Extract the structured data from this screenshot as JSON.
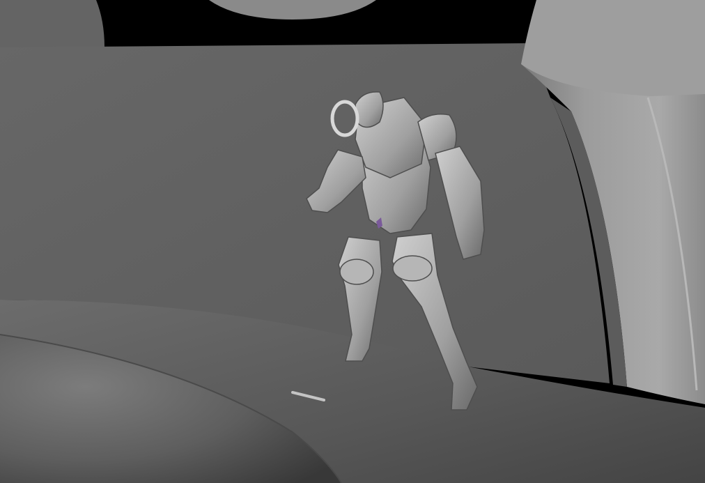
{
  "viewport": {
    "name": "3D viewport",
    "colors": {
      "background": "#000000",
      "wall": "#626262",
      "floor_light": "#7a7a7a",
      "floor_mid": "#5a5a5a",
      "floor_dark": "#3f3f3f",
      "pillar_light": "#a6a6a6",
      "pillar_mid": "#8a8a8a",
      "pillar_dark": "#6f6f6f",
      "ceiling_disc": "#888888",
      "robot_light": "#c8c8c8",
      "robot_mid": "#9a9a9a",
      "robot_dark": "#5e5e5e",
      "marker": "#c4c4c4"
    }
  }
}
